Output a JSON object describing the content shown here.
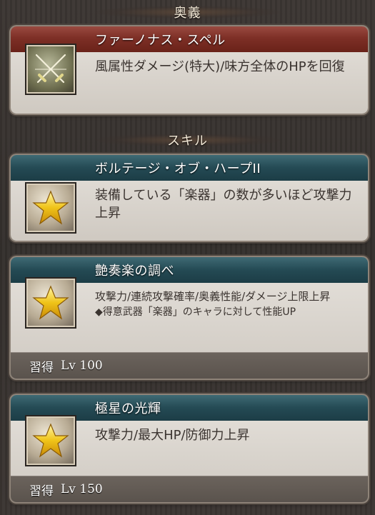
{
  "sections": {
    "ougi": "奥義",
    "skill": "スキル"
  },
  "ougi_card": {
    "title": "ファーノナス・スペル",
    "description": "風属性ダメージ(特大)/味方全体のHPを回復",
    "icon": "crossed-swords-icon"
  },
  "skills": [
    {
      "title": "ボルテージ・オブ・ハープII",
      "description": "装備している「楽器」の数が多いほど攻撃力上昇",
      "icon": "star-icon"
    },
    {
      "title": "艶奏楽の調べ",
      "description": "攻撃力/連続攻撃確率/奥義性能/ダメージ上限上昇",
      "note": "◆得意武器「楽器」のキャラに対して性能UP",
      "learn_label": "習得",
      "learn_level": "Lv 100",
      "icon": "star-icon"
    },
    {
      "title": "極星の光輝",
      "description": "攻撃力/最大HP/防御力上昇",
      "learn_label": "習得",
      "learn_level": "Lv 150",
      "icon": "star-icon"
    }
  ],
  "colors": {
    "ougi_header": "#7d2f26",
    "skill_header": "#244a54",
    "card_body": "#d9d4cd"
  }
}
